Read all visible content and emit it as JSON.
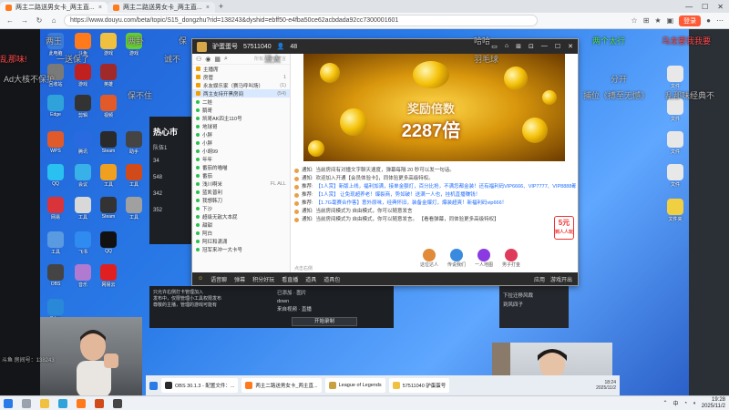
{
  "browser": {
    "tabs": [
      {
        "label": "两主二路送男女卡_两主直..."
      },
      {
        "label": "两主二路送男女卡_两主直..."
      }
    ],
    "url": "https://www.douyu.com/beta/topic/S15_dongzhu?rid=138243&dyshid=ebff50-e4fba50ce62acbdada92cc7300001601",
    "login_label": "登录"
  },
  "danmaku": [
    {
      "text": "两王",
      "cls": "gray"
    },
    {
      "text": "保",
      "cls": "gray"
    },
    {
      "text": "两卦",
      "cls": "gray"
    },
    {
      "text": "哈哈",
      "cls": "gray"
    },
    {
      "text": "两个太行",
      "cls": "green"
    },
    {
      "text": "乌龙要我我要",
      "cls": "red"
    },
    {
      "text": "乱那味!",
      "cls": "red"
    },
    {
      "text": "一送保了",
      "cls": "gray"
    },
    {
      "text": "诚不",
      "cls": "gray"
    },
    {
      "text": "没太",
      "cls": "gray"
    },
    {
      "text": "羽毛球",
      "cls": "gray"
    },
    {
      "text": "Ad大核不保护",
      "cls": "gray"
    },
    {
      "text": "分开",
      "cls": "gray"
    },
    {
      "text": "捕位《搏至无憾》",
      "cls": "gray"
    },
    {
      "text": "保不住",
      "cls": "gray"
    },
    {
      "text": "乱那味经典不",
      "cls": "gray"
    },
    {
      "text": "斗鱼 房间号：138243",
      "cls": "gray"
    }
  ],
  "chat_window": {
    "title": "驴蛋蛋号",
    "room": "57511040",
    "online": "48",
    "search_hint": "所有人可以发言",
    "members": [
      {
        "name": "主播席",
        "count": ""
      },
      {
        "name": "房管",
        "count": "1"
      },
      {
        "name": "永友娱乐家（赛马呼叫场）",
        "count": "(1)"
      },
      {
        "name": "两主支持开黑房间",
        "count": "(54)"
      },
      {
        "name": "二娃",
        "count": ""
      },
      {
        "name": "鹅哥",
        "count": ""
      },
      {
        "name": "凯哥AK四主110号",
        "count": ""
      },
      {
        "name": "地球哥",
        "count": ""
      },
      {
        "name": "小胖",
        "count": ""
      },
      {
        "name": "小胖",
        "count": ""
      },
      {
        "name": "小胡99",
        "count": ""
      },
      {
        "name": "年年",
        "count": ""
      },
      {
        "name": "番茄的喵喵",
        "count": ""
      },
      {
        "name": "番茄",
        "count": ""
      },
      {
        "name": "浅川啊米",
        "count": "FL ALL"
      },
      {
        "name": "蓝凯普利",
        "count": ""
      },
      {
        "name": "我想韩刀",
        "count": ""
      },
      {
        "name": "下沙",
        "count": ""
      },
      {
        "name": "超级无敌大本屁",
        "count": ""
      },
      {
        "name": "甜甜",
        "count": ""
      },
      {
        "name": "阿白",
        "count": ""
      },
      {
        "name": "阿红和潇潇",
        "count": ""
      },
      {
        "name": "冠军来冲一大卡号",
        "count": ""
      }
    ],
    "banner": {
      "title": "奖励倍数",
      "value": "2287倍"
    },
    "messages": [
      {
        "prefix": "通知:",
        "text": "当前房间有对撞文字聊天速度，弹幕每隔 20 秒可以发一句话。",
        "cls": ""
      },
      {
        "prefix": "通知:",
        "text": "欢迎加入开通【会员体验卡】，同体验更多高级特权。",
        "cls": ""
      },
      {
        "prefix": "推荐:",
        "text": "【1人赏】新版上线，福利加满，接单金额灯，百分比抢，不满您都金装！还有福利码VIP6666、VIP7777、VIP8888都可以",
        "cls": "blue"
      },
      {
        "prefix": "推荐:",
        "text": "【1人赏】 让免现超养老！爆裂商，势如破！送满一人也，挂机直播赚钱！",
        "cls": "blue"
      },
      {
        "prefix": "推荐:",
        "text": "【1.7G毫赛合作客】意外原味，经典怀旧，装备金爆灯，爆装超爽！新福利码vip666！",
        "cls": "blue"
      },
      {
        "prefix": "通知:",
        "text": "当前房间模式为 自由模式，你可以随意发言",
        "cls": ""
      },
      {
        "prefix": "通知:",
        "text": "当前房间模式为 自由模式，你可以随意发言。 【看看弹幕，同体验更多高级特权】",
        "cls": ""
      }
    ],
    "gifts": [
      {
        "label": "这位达人",
        "color": "#e08a3a"
      },
      {
        "label": "传说我们",
        "color": "#3a8ae0"
      },
      {
        "label": "一人地图",
        "color": "#8a3ae0"
      },
      {
        "label": "男子打金",
        "color": "#e03a5a"
      }
    ],
    "promo": {
      "value": "5元",
      "sub": "到人人玩"
    },
    "input_placeholder": "点击右侧",
    "input_tools": [
      "语音聊",
      "弹幕",
      "积分好玩",
      "看直播",
      "道具",
      "道具包"
    ],
    "right_tools": [
      "应用",
      "游戏开出"
    ]
  },
  "stream_panel": {
    "title": "热心市",
    "subtitle": "队伍1",
    "rows": [
      "34",
      "548",
      "342",
      "352"
    ],
    "obs_items": [
      "已添加 · 图片",
      "down",
      "来自视频 · 直播"
    ],
    "record_label": "开始录制",
    "lower_hint": "只允许右侧打卡管理加入",
    "lower_text_1": "发布中，仅限管理小工具权限发布",
    "lower_text_2": "尊敬的主播，管理的游戏可能有",
    "follow_user_1": "下拉迁移风裁",
    "follow_user_2": "到风四子"
  },
  "inner_taskbar": {
    "items": [
      {
        "label": "OBS 30.1.3 - 配置文件：...",
        "color": "#2a2a2a"
      },
      {
        "label": "两主二路送男女卡_两主直...",
        "color": "#ff7a1a"
      },
      {
        "label": "League of Legends",
        "color": "#c8a040"
      },
      {
        "label": "57511040 驴蛋蛋号",
        "color": "#f0c040"
      }
    ],
    "time": "18:24",
    "date": "2025/11/2"
  },
  "taskbar": {
    "time": "19:28",
    "date": "2025/11/2",
    "lang": "中"
  }
}
